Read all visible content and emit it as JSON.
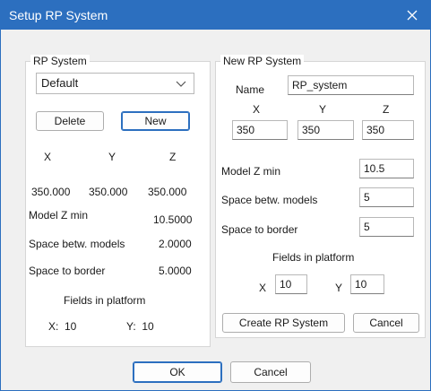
{
  "window": {
    "title": "Setup RP System"
  },
  "rp_system": {
    "legend": "RP System",
    "dropdown_value": "Default",
    "delete_label": "Delete",
    "new_label": "New",
    "axis_x": "X",
    "axis_y": "Y",
    "axis_z": "Z",
    "value_x": "350.000",
    "value_y": "350.000",
    "value_z": "350.000",
    "model_z_min_label": "Model Z min",
    "model_z_min_value": "10.5000",
    "space_models_label": "Space betw. models",
    "space_models_value": "2.0000",
    "space_border_label": "Space to border",
    "space_border_value": "5.0000",
    "fields_label": "Fields in platform",
    "fields_x": "X:  10",
    "fields_y": "Y:  10"
  },
  "new_rp_system": {
    "legend": "New RP System",
    "name_label": "Name",
    "name_value": "RP_system",
    "axis_x": "X",
    "axis_y": "Y",
    "axis_z": "Z",
    "value_x": "350",
    "value_y": "350",
    "value_z": "350",
    "model_z_min_label": "Model Z min",
    "model_z_min_value": "10.5",
    "space_models_label": "Space betw. models",
    "space_models_value": "5",
    "space_border_label": "Space to border",
    "space_border_value": "5",
    "fields_label": "Fields in platform",
    "fields_x_label": "X",
    "fields_x_value": "10",
    "fields_y_label": "Y",
    "fields_y_value": "10",
    "create_label": "Create RP System",
    "cancel_label": "Cancel"
  },
  "footer": {
    "ok_label": "OK",
    "cancel_label": "Cancel"
  },
  "icons": {
    "close": "close-icon",
    "dropdown": "chevron-down-icon"
  },
  "colors": {
    "titlebar": "#2c6fbf",
    "window_bg": "#f0f0f0",
    "group_bg": "#ffffff"
  }
}
